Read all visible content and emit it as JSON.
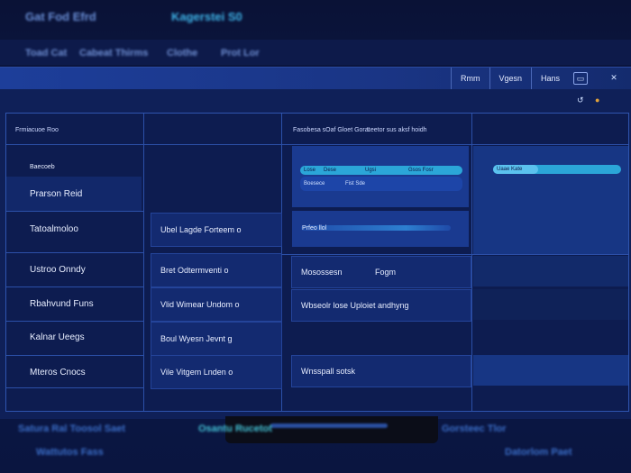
{
  "background": {
    "top_left": "Gat Fod Efrd",
    "top_center": "Kagerstei S0",
    "subbar": [
      "Toad Cat",
      "Cabeat Thirms",
      "Clothe",
      "Prot Lor"
    ],
    "bottom": [
      "Satura Ral Toosol Saet",
      "Osantu Rucetot",
      "Gorsteec Tlor",
      "Wattutos Fass",
      "Datorlom Paet"
    ]
  },
  "window": {
    "menu": [
      "Rmm",
      "Vgesn",
      "Hans"
    ],
    "controls": [
      "▭",
      "✕"
    ],
    "tool_icons": [
      "↺",
      "●"
    ]
  },
  "table": {
    "headers": {
      "left": "Frmiacuoe Roo",
      "mid": "Fasobesa sOaf Gloet Gorat",
      "right": "Leetor sus aksf hoidh"
    },
    "left_column": [
      {
        "title": "Baecoeb",
        "label": "Prarson Reid"
      },
      {
        "label": "Tatoalmoloo"
      },
      {
        "label": "Ustroo Onndy"
      },
      {
        "label": "Rbahvund Funs"
      },
      {
        "label": "Kalnar Ueegs"
      },
      {
        "label": "Mteros Cnocs"
      }
    ],
    "mid_column": [
      "Ubel Lagde Forteem o",
      "Bret Odtermventi o",
      "Vlid Wimear Undom o",
      "Boul Wyesn Jevnt g",
      "Vile Vitgem Lnden o"
    ],
    "right_column": {
      "top_pills": [
        "Lose",
        "Dese",
        "Ugsi",
        "Gsos Fosr"
      ],
      "top_sub": [
        "Boesece",
        "Fist Sde"
      ],
      "right_pill": "Uaae Kate",
      "progress_label": "Prfeo llol",
      "rows": [
        {
          "text": "Mosossesn",
          "extra": "Fogm"
        },
        {
          "text": "Wbseolr lose Uploiet andhyng"
        },
        {
          "text": "Wnsspall sotsk"
        }
      ]
    }
  },
  "colors": {
    "bg": "#0a1540",
    "panel": "#0d1c50",
    "accent": "#2ba6d8",
    "cell_highlight": "#1a3a90"
  }
}
